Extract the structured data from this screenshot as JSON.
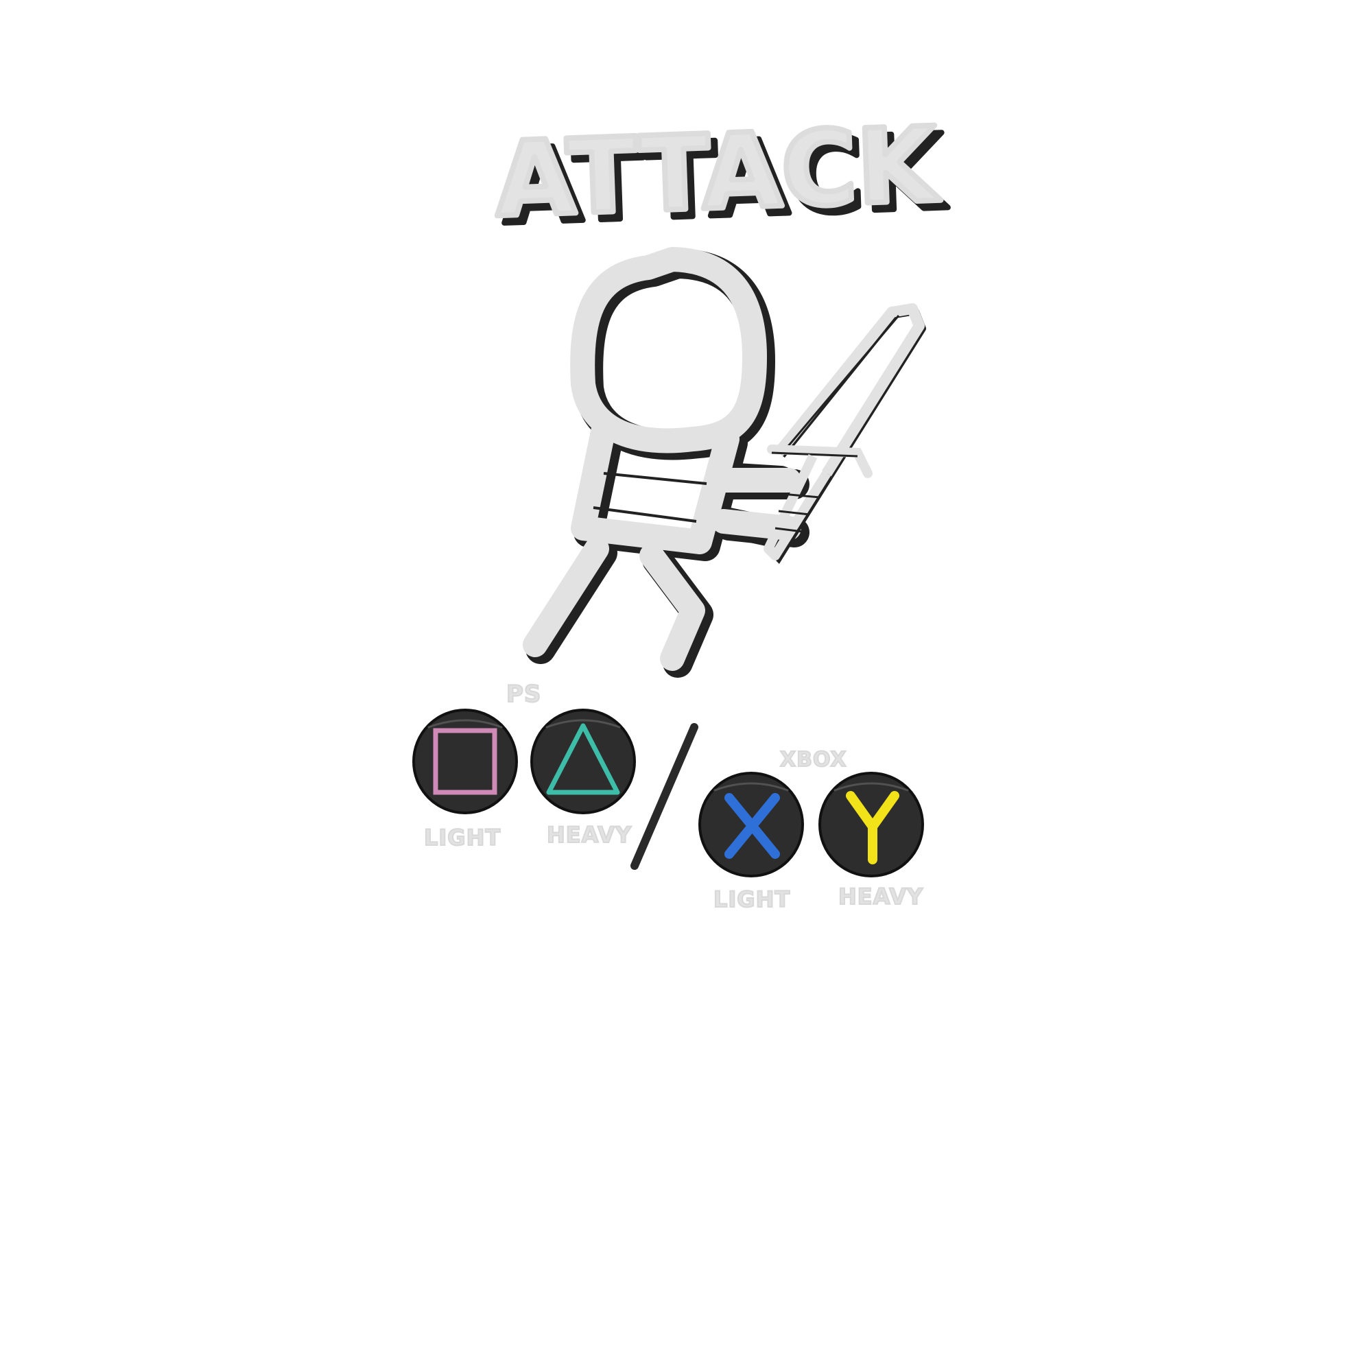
{
  "title": "ATTACK",
  "platforms": {
    "ps_label": "PS",
    "xbox_label": "XBOX"
  },
  "buttons": [
    {
      "id": "ps-square",
      "symbol": "square",
      "label": "LIGHT",
      "symbol_color": "#d08ab8"
    },
    {
      "id": "ps-triangle",
      "symbol": "triangle",
      "label": "HEAVY",
      "symbol_color": "#3dbda8"
    },
    {
      "id": "xbox-x",
      "symbol": "X",
      "label": "LIGHT",
      "symbol_color": "#2f6fd8"
    },
    {
      "id": "xbox-y",
      "symbol": "Y",
      "label": "HEAVY",
      "symbol_color": "#f2e21a"
    }
  ],
  "colors": {
    "sketch": "#e2e2e2",
    "outline": "#222222",
    "button_body": "#2d2d2d",
    "background": "#ffffff"
  },
  "icons": {
    "character": "stick-figure-with-sword-icon",
    "separator": "slash-divider-icon"
  }
}
